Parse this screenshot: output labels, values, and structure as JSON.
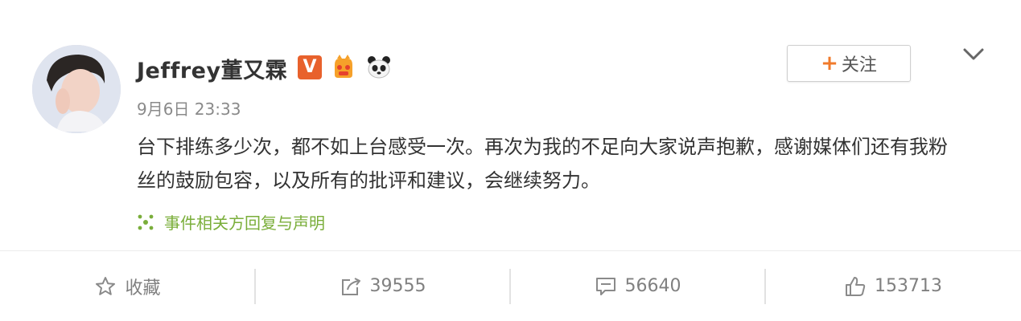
{
  "post": {
    "username": "Jeffrey董又霖",
    "verified_badge": "V",
    "timestamp": "9月6日 23:33",
    "content": "台下排练多少次，都不如上台感受一次。再次为我的不足向大家说声抱歉，感谢媒体们还有我粉丝的鼓励包容，以及所有的批评和建议，会继续努力。",
    "topic_link": "事件相关方回复与声明",
    "follow_button": {
      "plus": "+",
      "label": "关注"
    }
  },
  "actions": {
    "favorite_label": "收藏",
    "forward_count": "39555",
    "comment_count": "56640",
    "like_count": "153713"
  },
  "icons": {
    "dropdown": "chevron-down-icon",
    "favorite": "star-icon",
    "forward": "share-icon",
    "comment": "comment-icon",
    "like": "thumbs-up-icon",
    "topic": "topic-icon"
  },
  "colors": {
    "verified": "#e8612c",
    "follow_plus": "#f07a2b",
    "topic_link": "#7aae3a",
    "muted_text": "#808080"
  }
}
